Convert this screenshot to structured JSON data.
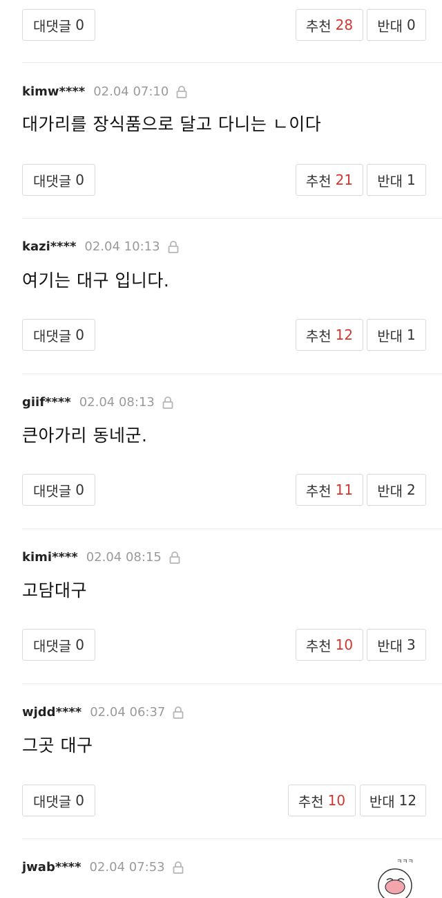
{
  "ui": {
    "reply_label": "대댓글",
    "recommend_label": "추천",
    "oppose_label": "반대"
  },
  "top_actions": {
    "reply_count": "0",
    "up": "28",
    "down": "0"
  },
  "comments": [
    {
      "user": "kimw****",
      "time": "02.04 07:10",
      "text": "대가리를 장식품으로 달고 다니는 ㄴ이다",
      "reply_count": "0",
      "up": "21",
      "down": "1"
    },
    {
      "user": "kazi****",
      "time": "02.04 10:13",
      "text": "여기는 대구 입니다.",
      "reply_count": "0",
      "up": "12",
      "down": "1"
    },
    {
      "user": "giif****",
      "time": "02.04 08:13",
      "text": "큰아가리 동네군.",
      "reply_count": "0",
      "up": "11",
      "down": "2"
    },
    {
      "user": "kimi****",
      "time": "02.04 08:15",
      "text": "고담대구",
      "reply_count": "0",
      "up": "10",
      "down": "3"
    },
    {
      "user": "wjdd****",
      "time": "02.04 06:37",
      "text": "그곳 대구",
      "reply_count": "0",
      "up": "10",
      "down": "12"
    },
    {
      "user": "jwab****",
      "time": "02.04 07:53"
    }
  ],
  "sticker_text": "ㅋㅋㅋ"
}
